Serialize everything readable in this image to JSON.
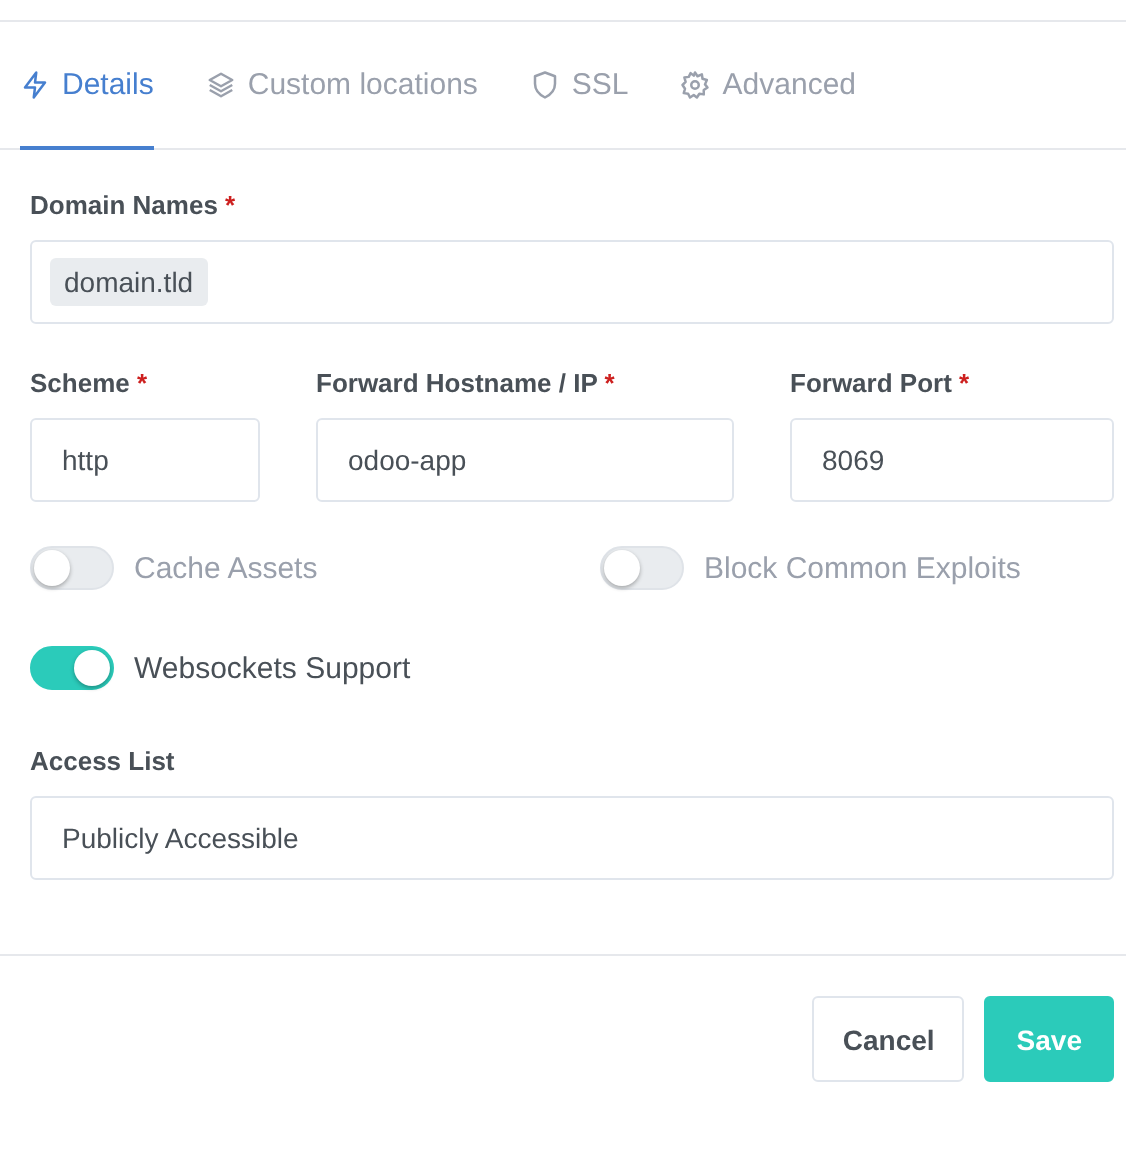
{
  "tabs": [
    {
      "label": "Details",
      "selected": true
    },
    {
      "label": "Custom locations",
      "selected": false
    },
    {
      "label": "SSL",
      "selected": false
    },
    {
      "label": "Advanced",
      "selected": false
    }
  ],
  "domain_names": {
    "label": "Domain Names",
    "required_mark": "*",
    "tags": [
      "domain.tld"
    ]
  },
  "fields": [
    {
      "label": "Scheme",
      "required_mark": "*",
      "value": "http"
    },
    {
      "label": "Forward Hostname / IP",
      "required_mark": "*",
      "value": "odoo-app"
    },
    {
      "label": "Forward Port",
      "required_mark": "*",
      "value": "8069"
    }
  ],
  "toggles": [
    {
      "label": "Cache Assets",
      "on": false
    },
    {
      "label": "Block Common Exploits",
      "on": false
    },
    {
      "label": "Websockets Support",
      "on": true
    }
  ],
  "access_list": {
    "label": "Access List",
    "value": "Publicly Accessible"
  },
  "buttons": [
    {
      "label": "Cancel",
      "kind": "secondary"
    },
    {
      "label": "Save",
      "kind": "primary"
    }
  ]
}
